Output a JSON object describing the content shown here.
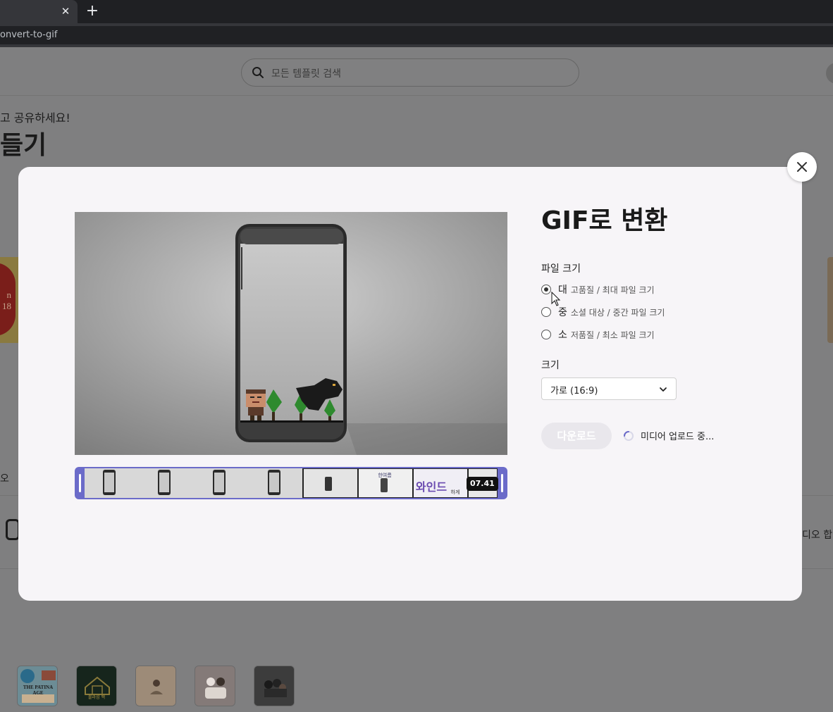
{
  "browser": {
    "tab_close_glyph": "✕",
    "new_tab_glyph": "+",
    "url": "onvert-to-gif"
  },
  "page": {
    "search_placeholder": "모든 템플릿 검색",
    "subheading": "고 공유하세요!",
    "title": "들기",
    "left_card_text": "n\n18",
    "side_label_left": "오",
    "side_label_right": "디오 합",
    "thumbnails": [
      {
        "label": "THE PATINA AGE",
        "color": "#5b7d8a"
      },
      {
        "label": "블라섬 맥",
        "color": "#1e3a2a"
      },
      {
        "label": "",
        "color": "#9a8a78"
      },
      {
        "label": "",
        "color": "#807878"
      },
      {
        "label": "",
        "color": "#3a3a3a"
      }
    ]
  },
  "modal": {
    "title": "GIF로 변환",
    "file_size_label": "파일 크기",
    "options": [
      {
        "main": "대",
        "sub": "고품질 / 최대 파일 크기",
        "checked": true
      },
      {
        "main": "중",
        "sub": "소셜 대상 / 중간 파일 크기",
        "checked": false
      },
      {
        "main": "소",
        "sub": "저품질 / 최소 파일 크기",
        "checked": false
      }
    ],
    "dimension_label": "크기",
    "dimension_value": "가로 (16:9)",
    "download_label": "다운로드",
    "status": "미디어 업로드 중...",
    "timeline_time": "07.41",
    "timeline_frame_texts": [
      "한여름",
      "와인드",
      "하게"
    ],
    "colors": {
      "accent": "#6b6bc9",
      "modal_bg": "#f7f5f8",
      "download_disabled": "#e9e7ec"
    }
  }
}
